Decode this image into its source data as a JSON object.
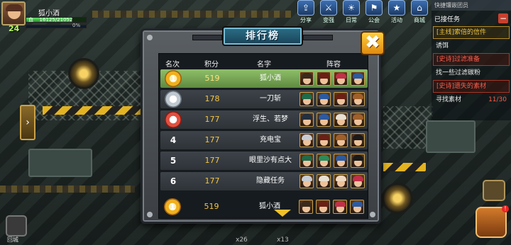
{
  "player": {
    "name": "狐小酒",
    "level": "24",
    "hp_label": "血",
    "hp_text": "16125/21052",
    "hp_fraction": 0.766,
    "xp_text": "0%",
    "xp_fraction": 0
  },
  "top_menu": [
    {
      "label": "分享",
      "icon": "share-icon"
    },
    {
      "label": "变强",
      "icon": "power-up-icon"
    },
    {
      "label": "日常",
      "icon": "daily-icon"
    },
    {
      "label": "公会",
      "icon": "guild-icon"
    },
    {
      "label": "活动",
      "icon": "event-icon"
    },
    {
      "label": "商城",
      "icon": "shop-icon"
    }
  ],
  "quests": {
    "title": "快捷镶嵌团员",
    "header": "已接任务",
    "items": [
      {
        "text": "[主线]索倍的信件",
        "style": "main"
      },
      {
        "text": "诱饵",
        "style": "white"
      },
      {
        "text": "[史诗]过滤准备",
        "style": "epic"
      },
      {
        "text": "找一些过滤碳粉",
        "style": "white"
      },
      {
        "text": "[史诗]遗失的素材",
        "style": "epic"
      },
      {
        "text": "寻找素材",
        "style": "white",
        "count": "11/30"
      }
    ]
  },
  "side": {
    "home_label": "回城",
    "count_a": "x26",
    "count_b": "x13"
  },
  "ranking": {
    "title": "排行榜",
    "close_glyph": "✖",
    "headers": {
      "rank": "名次",
      "score": "积分",
      "name": "名字",
      "team": "阵容"
    },
    "rows": [
      {
        "rank": "1",
        "medal": "1",
        "score": "519",
        "name": "狐小酒",
        "me": true,
        "team": [
          "#3a2a1c",
          "#6a2014",
          "#c03048",
          "#2c5aa0"
        ]
      },
      {
        "rank": "2",
        "medal": "2",
        "score": "178",
        "name": "一刀斩",
        "me": false,
        "team": [
          "#1e6a4a",
          "#2c5aa0",
          "#6a2014",
          "#a0602a"
        ]
      },
      {
        "rank": "3",
        "medal": "3",
        "score": "177",
        "name": "浮生、若梦",
        "me": false,
        "team": [
          "#223040",
          "#2c5aa0",
          "#e8e0d0",
          "#a0602a"
        ]
      },
      {
        "rank": "4",
        "medal": "",
        "score": "177",
        "name": "充电宝",
        "me": false,
        "team": [
          "#c8ccd4",
          "#6a2014",
          "#a0602a",
          "#1a1a1a"
        ]
      },
      {
        "rank": "5",
        "medal": "",
        "score": "177",
        "name": "眼里沙有点大",
        "me": false,
        "team": [
          "#1e6a4a",
          "#2c8a5a",
          "#2c5aa0",
          "#1a1a1a"
        ]
      },
      {
        "rank": "6",
        "medal": "",
        "score": "177",
        "name": "隐藏任务",
        "me": false,
        "team": [
          "#c8ccd4",
          "#e8e0d0",
          "#f0d8c0",
          "#c03048"
        ]
      }
    ],
    "my_row": {
      "rank": "1",
      "medal": "1",
      "score": "519",
      "name": "狐小酒",
      "team": [
        "#3a2a1c",
        "#6a2014",
        "#c03048",
        "#2c5aa0"
      ]
    }
  }
}
